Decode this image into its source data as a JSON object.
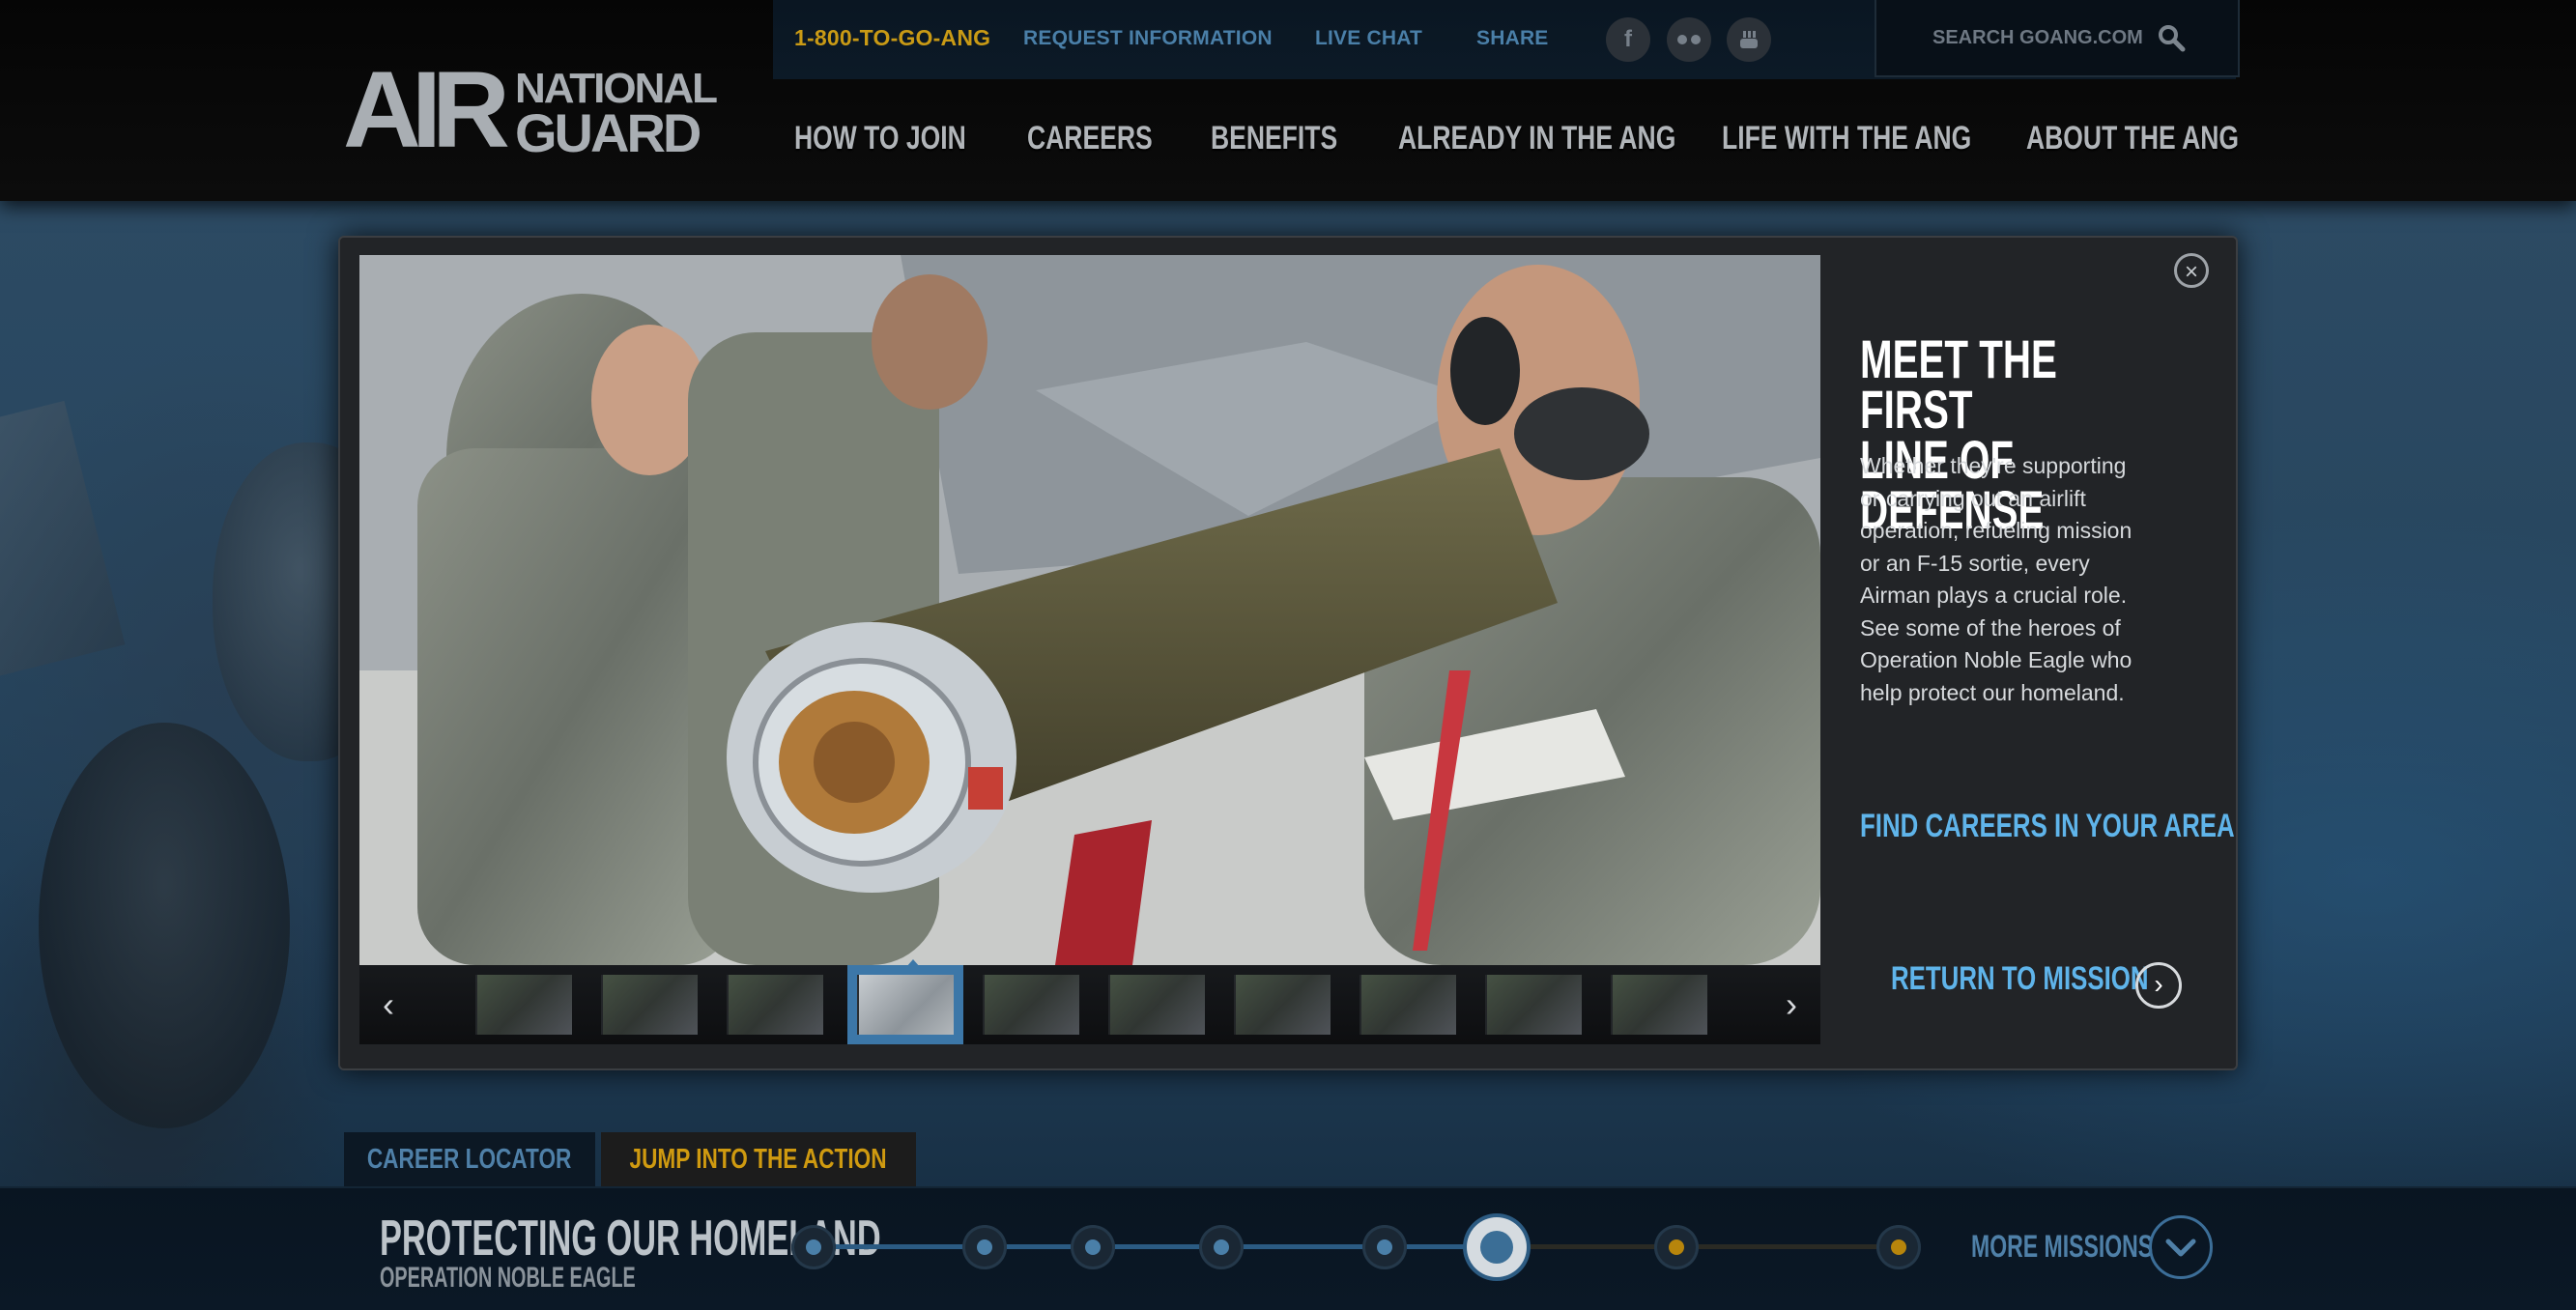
{
  "utility_bar": {
    "phone": "1-800-TO-GO-ANG",
    "links": [
      "REQUEST INFORMATION",
      "LIVE CHAT",
      "SHARE"
    ],
    "social": [
      "facebook-icon",
      "flickr-icon",
      "youtube-icon"
    ],
    "search_label": "SEARCH GOANG.COM"
  },
  "logo": {
    "air": "AIR",
    "national": "NATIONAL",
    "guard": "GUARD"
  },
  "nav": {
    "items": [
      "HOW TO JOIN",
      "CAREERS",
      "BENEFITS",
      "ALREADY IN THE ANG",
      "LIFE WITH THE ANG",
      "ABOUT THE ANG"
    ]
  },
  "modal": {
    "close_icon": "×",
    "title": "MEET THE FIRST\nLINE OF DEFENSE",
    "body": "Whether they're supporting or carrying out an airlift operation, refueling mission or an F-15 sortie, every Airman plays a crucial role. See some of the heroes of Operation Noble Eagle who help protect our homeland.",
    "cta": "FIND CAREERS IN YOUR AREA",
    "return_label": "RETURN TO MISSION",
    "thumbnails": {
      "count": 10,
      "active_index": 3
    }
  },
  "tabs": {
    "career_locator": "CAREER LOCATOR",
    "jump": "JUMP INTO THE ACTION"
  },
  "timeline": {
    "title": "PROTECTING OUR HOMELAND",
    "subtitle": "OPERATION NOBLE EAGLE",
    "more_label": "MORE MISSIONS",
    "stops": 8,
    "current_stop": 6
  },
  "colors": {
    "accent_blue": "#5fb4ea",
    "gold": "#c99a15",
    "nav_text": "#b1b5b9"
  }
}
